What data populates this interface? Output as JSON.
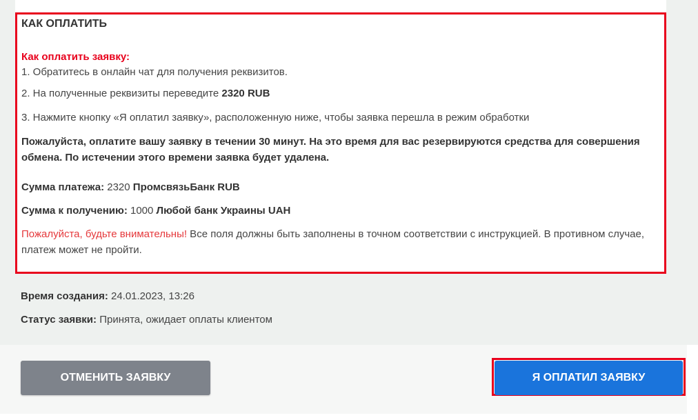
{
  "instructions": {
    "heading": "КАК ОПЛАТИТЬ",
    "subheading": "Как оплатить заявку:",
    "step1": "1. Обратитесь в онлайн чат для получения реквизитов.",
    "step2_prefix": "2. На полученные реквизиты переведите ",
    "step2_amount": "2320 RUB",
    "step3": "3. Нажмите кнопку «Я оплатил заявку», расположенную ниже, чтобы заявка перешла в режим обработки",
    "time_notice": "Пожалуйста, оплатите вашу заявку в течении 30 минут. На это время для вас резервируются средства для совершения обмена. По истечении этого времени заявка будет удалена.",
    "payment_label": "Сумма платежа:",
    "payment_amount": " 2320 ",
    "payment_bank": "ПромсвязьБанк RUB",
    "receive_label": "Сумма к получению:",
    "receive_amount": " 1000 ",
    "receive_bank": "Любой банк Украины UAH",
    "warning_highlight": "Пожалуйста, будьте внимательны!",
    "warning_text": " Все поля должны быть заполнены в точном соответствии с инструкцией. В противном случае, платеж может не пройти."
  },
  "meta": {
    "created_label": "Время создания:",
    "created_value": " 24.01.2023, 13:26",
    "status_label": "Статус заявки:",
    "status_value": " Принята, ожидает оплаты клиентом"
  },
  "actions": {
    "cancel_label": "ОТМЕНИТЬ ЗАЯВКУ",
    "paid_label": "Я ОПЛАТИЛ ЗАЯВКУ"
  },
  "colors": {
    "accent_red": "#e8001c",
    "primary_button": "#1a74dc",
    "secondary_button": "#7e838b"
  }
}
